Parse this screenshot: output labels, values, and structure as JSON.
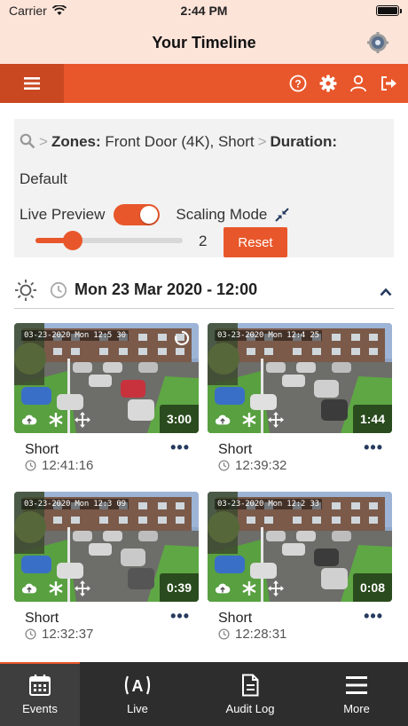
{
  "status_bar": {
    "carrier": "Carrier",
    "time": "2:44 PM"
  },
  "title_bar": {
    "title": "Your Timeline",
    "settings_icon": "gear-icon"
  },
  "nav_bar": {
    "menu_icon": "hamburger-icon",
    "icons": [
      "help-icon",
      "settings-icon",
      "user-icon",
      "logout-icon"
    ],
    "accent": "#e8572b"
  },
  "filters": {
    "zones_label": "Zones:",
    "zones_value": "Front Door (4K), Short",
    "duration_label": "Duration:",
    "duration_value": "Default",
    "live_preview_label": "Live Preview",
    "live_preview_on": true,
    "scaling_mode_label": "Scaling Mode",
    "scale_value": "2",
    "scale_fraction": 0.25,
    "reset_label": "Reset"
  },
  "timeline": {
    "date": "Mon 23 Mar 2020 - 12:00",
    "cards": [
      {
        "timestamp": "03-23-2020 Mon 12:5 30",
        "duration": "3:00",
        "label": "Short",
        "time": "12:41:16",
        "loading": true
      },
      {
        "timestamp": "03-23-2020 Mon 12:4 25",
        "duration": "1:44",
        "label": "Short",
        "time": "12:39:32",
        "loading": false
      },
      {
        "timestamp": "03-23-2020 Mon 12:3 09",
        "duration": "0:39",
        "label": "Short",
        "time": "12:32:37",
        "loading": false
      },
      {
        "timestamp": "03-23-2020 Mon 12:2 33",
        "duration": "0:08",
        "label": "Short",
        "time": "12:28:31",
        "loading": false
      }
    ]
  },
  "tab_bar": {
    "tabs": [
      {
        "label": "Events",
        "icon": "calendar-icon",
        "active": true
      },
      {
        "label": "Live",
        "icon": "broadcast-icon",
        "active": false
      },
      {
        "label": "Audit Log",
        "icon": "document-icon",
        "active": false
      },
      {
        "label": "More",
        "icon": "menu-icon",
        "active": false
      }
    ]
  }
}
